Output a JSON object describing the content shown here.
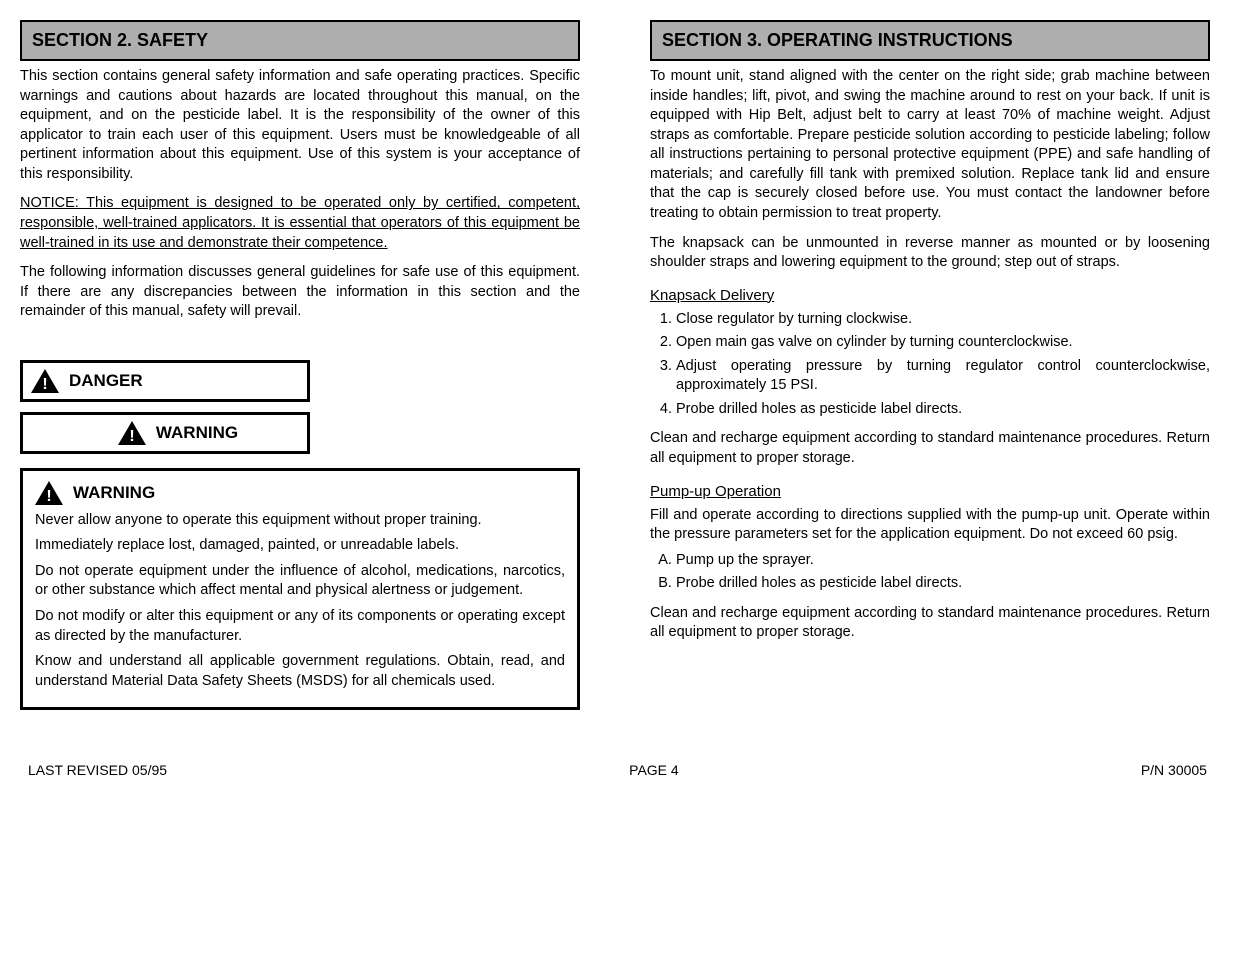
{
  "left": {
    "section_title": "SECTION 2.  SAFETY",
    "para1": "This section contains general safety information and safe operating practices. Specific warnings and cautions about hazards are located throughout this manual, on the equipment, and on the pesticide label. It is the responsibility of the owner of this applicator to train each user of this equipment. Users must be knowledgeable of all pertinent information about this equipment. Use of this system is your acceptance of this responsibility.",
    "para2_lead": "NOTICE: ",
    "para2_body": "This equipment is designed to be operated only by certified, competent, responsible, well-trained applicators. It is essential that operators of this equipment be well-trained in its use and demonstrate their competence.",
    "para3": "The following information discusses general guidelines for safe use of this equipment. If there are any discrepancies between the information in this section and the remainder of this manual, safety will prevail.",
    "warn_danger": "DANGER",
    "warn_warning": "WARNING",
    "full_warn_title": "WARNING",
    "full_p1": "Never allow anyone to operate this equipment without proper training.",
    "full_p2": "Immediately replace lost, damaged, painted, or unreadable labels.",
    "full_p3": "Do not operate equipment under the influence of alcohol, medications, narcotics, or other substance which affect mental and physical alertness or judgement.",
    "full_p4": "Do not modify or alter this equipment or any of its components or operating except as directed by the manufacturer.",
    "full_p5": "Know and understand all applicable government regulations. Obtain, read, and understand Material Data Safety Sheets (MSDS) for all chemicals used."
  },
  "right": {
    "section_title": "SECTION 3.  OPERATING INSTRUCTIONS",
    "para1": "To mount unit, stand aligned with the center on the right side; grab machine between inside handles; lift, pivot, and swing the machine around to rest on your back. If unit is equipped with Hip Belt, adjust belt to carry at least 70% of machine weight. Adjust straps as comfortable. Prepare pesticide solution according to pesticide labeling; follow all instructions pertaining to personal protective equipment (PPE) and safe handling of materials; and carefully fill tank with premixed solution. Replace tank lid and ensure that the cap is securely closed before use. You must contact the landowner before treating to obtain permission to treat property.",
    "para2": "The knapsack can be unmounted in reverse manner as mounted or by loosening shoulder straps and lowering equipment to the ground; step out of straps.",
    "sub1_title": "Knapsack Delivery",
    "k_steps": [
      "Close regulator by turning clockwise.",
      "Open main gas valve on cylinder by turning counterclockwise.",
      "Adjust operating pressure by turning regulator control counterclockwise, approximately 15 PSI.",
      "Probe drilled holes as pesticide label directs."
    ],
    "k_post": "Clean and recharge equipment according to standard maintenance procedures. Return all equipment to proper storage.",
    "sub2_title": "Pump-up Operation",
    "pu_intro": "Fill and operate according to directions supplied with the pump-up unit. Operate within the pressure parameters set for the application equipment. Do not exceed 60 psig.",
    "pu_steps": [
      "Pump up the sprayer.",
      "Probe drilled holes as pesticide label directs."
    ],
    "pu_post": "Clean and recharge equipment according to standard maintenance procedures. Return all equipment to proper storage."
  },
  "footer": {
    "left": "LAST REVISED 05/95",
    "center": "PAGE 4",
    "right": "P/N 30005"
  }
}
